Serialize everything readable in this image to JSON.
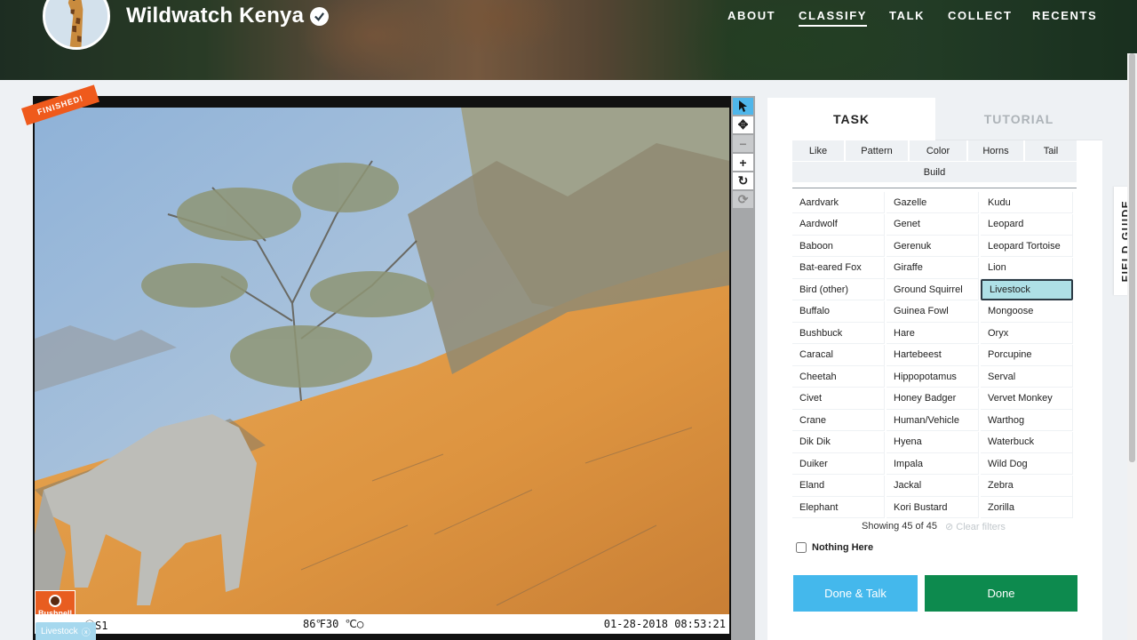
{
  "header": {
    "title": "Wildwatch Kenya",
    "nav": [
      "ABOUT",
      "CLASSIFY",
      "TALK",
      "COLLECT",
      "RECENTS"
    ],
    "active_nav": "CLASSIFY"
  },
  "viewer": {
    "ribbon": "FINISHED!",
    "camera_brand": "Bushnell",
    "camera_id": "ⓂS1",
    "temperature": "86℉30 ℃◯",
    "timestamp": "01-28-2018 08:53:21",
    "selected_tag": "Livestock",
    "tools": [
      "pointer-icon",
      "move-icon",
      "zoom-out-icon",
      "zoom-in-icon",
      "rotate-icon",
      "reset-icon"
    ]
  },
  "task": {
    "tabs": [
      "TASK",
      "TUTORIAL"
    ],
    "filters": [
      "Like",
      "Pattern",
      "Color",
      "Horns",
      "Tail",
      "Build"
    ],
    "species": [
      [
        "Aardvark",
        "Gazelle",
        "Kudu"
      ],
      [
        "Aardwolf",
        "Genet",
        "Leopard"
      ],
      [
        "Baboon",
        "Gerenuk",
        "Leopard Tortoise"
      ],
      [
        "Bat-eared Fox",
        "Giraffe",
        "Lion"
      ],
      [
        "Bird (other)",
        "Ground Squirrel",
        "Livestock"
      ],
      [
        "Buffalo",
        "Guinea Fowl",
        "Mongoose"
      ],
      [
        "Bushbuck",
        "Hare",
        "Oryx"
      ],
      [
        "Caracal",
        "Hartebeest",
        "Porcupine"
      ],
      [
        "Cheetah",
        "Hippopotamus",
        "Serval"
      ],
      [
        "Civet",
        "Honey Badger",
        "Vervet Monkey"
      ],
      [
        "Crane",
        "Human/Vehicle",
        "Warthog"
      ],
      [
        "Dik Dik",
        "Hyena",
        "Waterbuck"
      ],
      [
        "Duiker",
        "Impala",
        "Wild Dog"
      ],
      [
        "Eland",
        "Jackal",
        "Zebra"
      ],
      [
        "Elephant",
        "Kori Bustard",
        "Zorilla"
      ]
    ],
    "selected_species": "Livestock",
    "showing": "Showing 45 of 45",
    "clear_filters": "Clear filters",
    "nothing_here": "Nothing Here",
    "done_talk": "Done & Talk",
    "done": "Done"
  },
  "field_guide": "FIELD GUIDE",
  "colors": {
    "accent_blue": "#44b8ec",
    "done_green": "#0d8a4e",
    "ribbon_orange": "#ef5a1c",
    "selected_cell": "#aee0e6"
  }
}
